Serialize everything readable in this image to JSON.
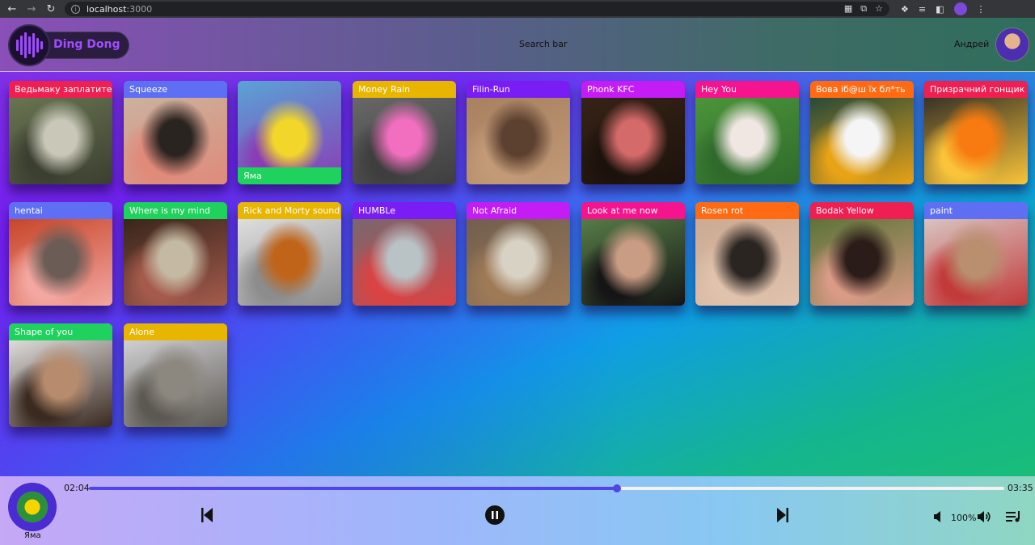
{
  "browser": {
    "url_host": "localhost",
    "url_port": ":3000"
  },
  "header": {
    "app_name": "Ding Dong",
    "search_label": "Search bar",
    "user_name": "Андрей"
  },
  "cards": [
    {
      "title": "Ведьмаку заплатите",
      "color": "#ef1f52",
      "label_pos": "top",
      "art": [
        "#6e7b55",
        "#c9c7b8",
        "#3b3f30"
      ]
    },
    {
      "title": "Squeeze",
      "color": "#5f6ff4",
      "label_pos": "top",
      "art": [
        "#c7b7a3",
        "#2a2420",
        "#e08a7a"
      ]
    },
    {
      "title": "Яма",
      "color": "#1fd15d",
      "label_pos": "bottom",
      "art": [
        "#5aa3d6",
        "#f2d72a",
        "#8a3bb5"
      ]
    },
    {
      "title": "Money Rain",
      "color": "#e8b600",
      "label_pos": "top",
      "art": [
        "#6d6d6d",
        "#f26fbf",
        "#3e3e3e"
      ]
    },
    {
      "title": "Filin-Run",
      "color": "#7a1cf4",
      "label_pos": "top",
      "art": [
        "#a47d5e",
        "#5c4030",
        "#c29a77"
      ]
    },
    {
      "title": "Phonk KFC",
      "color": "#c31cf4",
      "label_pos": "top",
      "art": [
        "#3a2518",
        "#d46a6a",
        "#1c120c"
      ]
    },
    {
      "title": "Hey You",
      "color": "#f5138e",
      "label_pos": "top",
      "art": [
        "#4f9a3c",
        "#f0e6e2",
        "#2f6a2b"
      ]
    },
    {
      "title": "Вова іб@ш їх бл*ть",
      "color": "#ff6a13",
      "label_pos": "top",
      "art": [
        "#0e3d3d",
        "#f5f5f5",
        "#e8a317"
      ]
    },
    {
      "title": "Призрачний гонщик",
      "color": "#ef1f52",
      "label_pos": "top",
      "art": [
        "#1e1e24",
        "#f77b10",
        "#f9c43a"
      ]
    },
    {
      "title": "hentai",
      "color": "#5f6ff4",
      "label_pos": "top",
      "art": [
        "#c2381a",
        "#6b5c55",
        "#f3a7a0"
      ]
    },
    {
      "title": "Where is my mind",
      "color": "#1fd15d",
      "label_pos": "top",
      "art": [
        "#2a1e14",
        "#c4b9a2",
        "#a55b4c"
      ]
    },
    {
      "title": "Rick and Morty sound",
      "color": "#e8b600",
      "label_pos": "top",
      "art": [
        "#e9e9e9",
        "#c0641a",
        "#8c8c8c"
      ]
    },
    {
      "title": "HUMBLe",
      "color": "#7a1cf4",
      "label_pos": "top",
      "art": [
        "#6c6c74",
        "#b9c2c5",
        "#d94343"
      ]
    },
    {
      "title": "Not Afraid",
      "color": "#c31cf4",
      "label_pos": "top",
      "art": [
        "#6b5b4d",
        "#d8d2c5",
        "#9e7a57"
      ]
    },
    {
      "title": "Look at me now",
      "color": "#f5138e",
      "label_pos": "top",
      "art": [
        "#5f8a4e",
        "#c99c84",
        "#151515"
      ]
    },
    {
      "title": "Rosen rot",
      "color": "#ff6a13",
      "label_pos": "top",
      "art": [
        "#c9a790",
        "#2b2522",
        "#e0c2ad"
      ]
    },
    {
      "title": "Bodak Yellow",
      "color": "#ef1f52",
      "label_pos": "top",
      "art": [
        "#4b6e2d",
        "#2a1c18",
        "#d99a86"
      ]
    },
    {
      "title": "paint",
      "color": "#5f6ff4",
      "label_pos": "top",
      "art": [
        "#dbd6d2",
        "#b98f70",
        "#c23a3a"
      ]
    },
    {
      "title": "Shape of you",
      "color": "#1fd15d",
      "label_pos": "top",
      "art": [
        "#f4f4f4",
        "#b78c6e",
        "#3a2a20"
      ]
    },
    {
      "title": "Alone",
      "color": "#e8b600",
      "label_pos": "top",
      "art": [
        "#dfdfe3",
        "#8c877f",
        "#5c5852"
      ]
    }
  ],
  "player": {
    "track_title": "Яма",
    "current_time": "02:04",
    "total_time": "03:35",
    "progress": 0.577,
    "volume_label": "100%"
  }
}
